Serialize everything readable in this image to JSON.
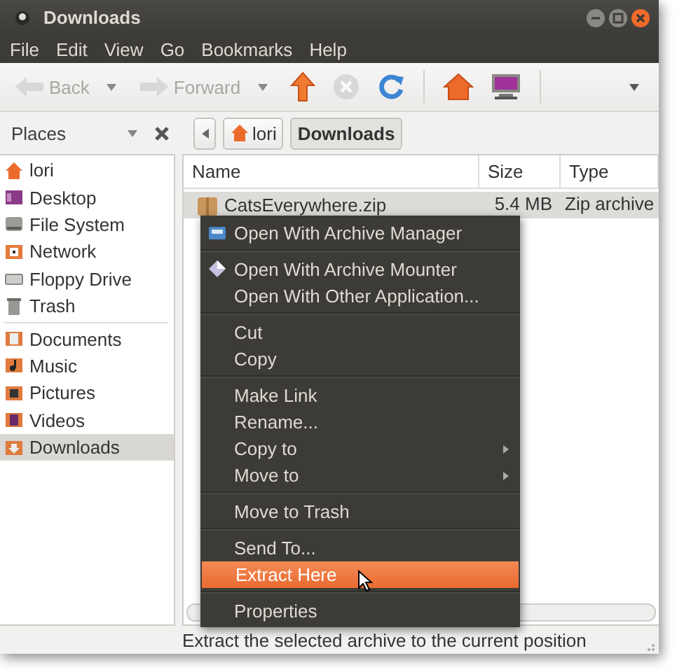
{
  "window": {
    "title": "Downloads"
  },
  "menubar": [
    "File",
    "Edit",
    "View",
    "Go",
    "Bookmarks",
    "Help"
  ],
  "toolbar": [
    {
      "kind": "back",
      "label": "Back",
      "disabled": true
    },
    {
      "kind": "forward",
      "label": "Forward",
      "disabled": true
    },
    {
      "kind": "up",
      "disabled": false
    },
    {
      "kind": "stop",
      "disabled": true
    },
    {
      "kind": "reload",
      "disabled": false
    },
    {
      "kind": "home",
      "disabled": false
    },
    {
      "kind": "computer",
      "disabled": false
    }
  ],
  "places": {
    "label": "Places"
  },
  "breadcrumbs": [
    {
      "kind": "home",
      "label": "lori",
      "selected": false
    },
    {
      "kind": "folder",
      "label": "Downloads",
      "selected": true
    }
  ],
  "sidebar": {
    "groups": [
      [
        {
          "kind": "home",
          "label": "lori",
          "selected": false
        },
        {
          "kind": "desktop",
          "label": "Desktop",
          "selected": false
        },
        {
          "kind": "drive",
          "label": "File System",
          "selected": false
        },
        {
          "kind": "network",
          "label": "Network",
          "selected": false
        },
        {
          "kind": "floppy",
          "label": "Floppy Drive",
          "selected": false
        },
        {
          "kind": "trash",
          "label": "Trash",
          "selected": false
        }
      ],
      [
        {
          "kind": "documents",
          "label": "Documents",
          "selected": false
        },
        {
          "kind": "music",
          "label": "Music",
          "selected": false
        },
        {
          "kind": "pictures",
          "label": "Pictures",
          "selected": false
        },
        {
          "kind": "videos",
          "label": "Videos",
          "selected": false
        },
        {
          "kind": "downloads",
          "label": "Downloads",
          "selected": true
        }
      ]
    ]
  },
  "file_list": {
    "columns": [
      "Name",
      "Size",
      "Type"
    ],
    "rows": [
      {
        "name": "CatsEverywhere.zip",
        "size": "5.4 MB",
        "type": "Zip archive",
        "selected": true
      }
    ]
  },
  "context_menu": {
    "sections": [
      [
        {
          "kind": "archive-app",
          "label": "Open With Archive Manager",
          "selected": false
        }
      ],
      [
        {
          "kind": "mounter-app",
          "label": "Open With Archive Mounter",
          "selected": false
        },
        {
          "kind": "item",
          "label": "Open With Other Application...",
          "selected": false
        }
      ],
      [
        {
          "kind": "item",
          "label": "Cut",
          "selected": false
        },
        {
          "kind": "item",
          "label": "Copy",
          "selected": false
        }
      ],
      [
        {
          "kind": "item",
          "label": "Make Link",
          "selected": false
        },
        {
          "kind": "item",
          "label": "Rename...",
          "selected": false
        },
        {
          "kind": "submenu",
          "label": "Copy to",
          "selected": false
        },
        {
          "kind": "submenu",
          "label": "Move to",
          "selected": false
        }
      ],
      [
        {
          "kind": "item",
          "label": "Move to Trash",
          "selected": false
        }
      ],
      [
        {
          "kind": "item",
          "label": "Send To...",
          "selected": false
        },
        {
          "kind": "item",
          "label": "Extract Here",
          "selected": true
        }
      ],
      [
        {
          "kind": "item",
          "label": "Properties",
          "selected": false
        }
      ]
    ]
  },
  "status_bar": "Extract the selected archive to the current position"
}
